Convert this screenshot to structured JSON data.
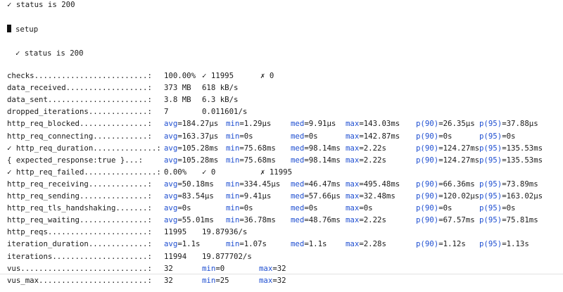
{
  "header": {
    "line1": "✓ status is 200",
    "group": "setup",
    "line3": "✓ status is 200"
  },
  "rows": [
    {
      "name": "checks.........................:",
      "cells": [
        "100.00%",
        "✓ 11995",
        "",
        "✗ 0"
      ]
    },
    {
      "name": "data_received..................:",
      "cells": [
        "373 MB",
        "618 kB/s"
      ]
    },
    {
      "name": "data_sent......................:",
      "cells": [
        "3.8 MB",
        "6.3 kB/s"
      ]
    },
    {
      "name": "dropped_iterations.............:",
      "cells": [
        "7",
        "0.011601/s"
      ]
    },
    {
      "name": "http_req_blocked...............:",
      "stats": [
        [
          "avg",
          "184.27µs"
        ],
        [
          "min",
          "1.29µs"
        ],
        [
          "med",
          "9.91µs"
        ],
        [
          "max",
          "143.03ms"
        ],
        [
          "p(90)",
          "26.35µs"
        ],
        [
          "p(95)",
          "37.88µs"
        ]
      ]
    },
    {
      "name": "http_req_connecting............:",
      "stats": [
        [
          "avg",
          "163.37µs"
        ],
        [
          "min",
          "0s"
        ],
        [
          "med",
          "0s"
        ],
        [
          "max",
          "142.87ms"
        ],
        [
          "p(90)",
          "0s"
        ],
        [
          "p(95)",
          "0s"
        ]
      ]
    },
    {
      "name": "✓ http_req_duration..............:",
      "stats": [
        [
          "avg",
          "105.28ms"
        ],
        [
          "min",
          "75.68ms"
        ],
        [
          "med",
          "98.14ms"
        ],
        [
          "max",
          "2.22s"
        ],
        [
          "p(90)",
          "124.27ms"
        ],
        [
          "p(95)",
          "135.53ms"
        ]
      ]
    },
    {
      "name": "{ expected_response:true }...:",
      "stats": [
        [
          "avg",
          "105.28ms"
        ],
        [
          "min",
          "75.68ms"
        ],
        [
          "med",
          "98.14ms"
        ],
        [
          "max",
          "2.22s"
        ],
        [
          "p(90)",
          "124.27ms"
        ],
        [
          "p(95)",
          "135.53ms"
        ]
      ]
    },
    {
      "name": "✓ http_req_failed................:",
      "cells": [
        "0.00%",
        "✓ 0",
        "",
        "✗ 11995"
      ]
    },
    {
      "name": "http_req_receiving.............:",
      "stats": [
        [
          "avg",
          "50.18ms"
        ],
        [
          "min",
          "334.45µs"
        ],
        [
          "med",
          "46.47ms"
        ],
        [
          "max",
          "495.48ms"
        ],
        [
          "p(90)",
          "66.36ms"
        ],
        [
          "p(95)",
          "73.89ms"
        ]
      ]
    },
    {
      "name": "http_req_sending...............:",
      "stats": [
        [
          "avg",
          "83.54µs"
        ],
        [
          "min",
          "9.41µs"
        ],
        [
          "med",
          "57.66µs"
        ],
        [
          "max",
          "32.48ms"
        ],
        [
          "p(90)",
          "120.02µs"
        ],
        [
          "p(95)",
          "163.02µs"
        ]
      ]
    },
    {
      "name": "http_req_tls_handshaking.......:",
      "stats": [
        [
          "avg",
          "0s"
        ],
        [
          "min",
          "0s"
        ],
        [
          "med",
          "0s"
        ],
        [
          "max",
          "0s"
        ],
        [
          "p(90)",
          "0s"
        ],
        [
          "p(95)",
          "0s"
        ]
      ]
    },
    {
      "name": "http_req_waiting...............:",
      "stats": [
        [
          "avg",
          "55.01ms"
        ],
        [
          "min",
          "36.78ms"
        ],
        [
          "med",
          "48.76ms"
        ],
        [
          "max",
          "2.22s"
        ],
        [
          "p(90)",
          "67.57ms"
        ],
        [
          "p(95)",
          "75.81ms"
        ]
      ]
    },
    {
      "name": "http_reqs......................:",
      "cells": [
        "11995",
        "19.87936/s"
      ]
    },
    {
      "name": "iteration_duration.............:",
      "stats": [
        [
          "avg",
          "1.1s"
        ],
        [
          "min",
          "1.07s"
        ],
        [
          "med",
          "1.1s"
        ],
        [
          "max",
          "2.28s"
        ],
        [
          "p(90)",
          "1.12s"
        ],
        [
          "p(95)",
          "1.13s"
        ]
      ]
    },
    {
      "name": "iterations.....................:",
      "cells": [
        "11994",
        "19.877702/s"
      ]
    },
    {
      "name": "vus............................:",
      "stats": [
        [
          "",
          "32"
        ],
        [
          "min",
          "0"
        ],
        [
          "max",
          "32"
        ]
      ]
    },
    {
      "name": "vus_max........................:",
      "stats": [
        [
          "",
          "32"
        ],
        [
          "min",
          "25"
        ],
        [
          "max",
          "32"
        ]
      ]
    }
  ],
  "colors": {
    "key": "#1f4fd1",
    "text": "#1a1a1a",
    "separator": "#e3e3e3"
  }
}
